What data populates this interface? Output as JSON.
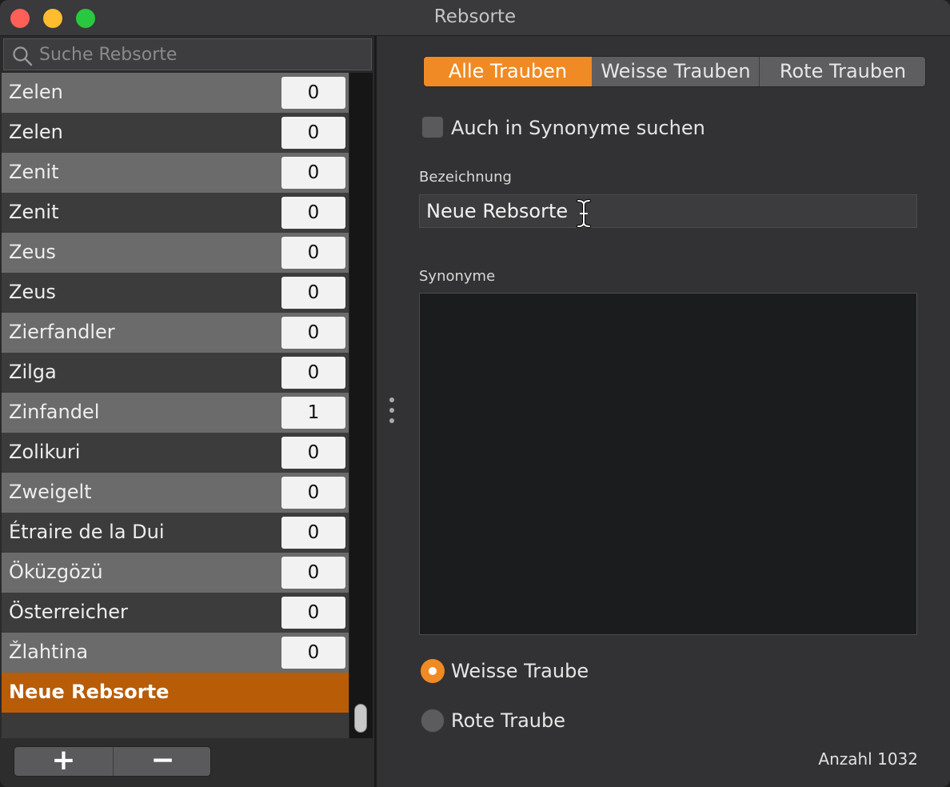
{
  "window": {
    "title": "Rebsorte"
  },
  "search": {
    "placeholder": "Suche Rebsorte"
  },
  "list": {
    "rows": [
      {
        "name": "Zelen",
        "count": "0"
      },
      {
        "name": "Zelen",
        "count": "0"
      },
      {
        "name": "Zenit",
        "count": "0"
      },
      {
        "name": "Zenit",
        "count": "0"
      },
      {
        "name": "Zeus",
        "count": "0"
      },
      {
        "name": "Zeus",
        "count": "0"
      },
      {
        "name": "Zierfandler",
        "count": "0"
      },
      {
        "name": "Zilga",
        "count": "0"
      },
      {
        "name": "Zinfandel",
        "count": "1"
      },
      {
        "name": "Zolikuri",
        "count": "0"
      },
      {
        "name": "Zweigelt",
        "count": "0"
      },
      {
        "name": "Étraire de la Dui",
        "count": "0"
      },
      {
        "name": "Öküzgözü",
        "count": "0"
      },
      {
        "name": "Österreicher",
        "count": "0"
      },
      {
        "name": "Žlahtina",
        "count": "0"
      },
      {
        "name": "Neue Rebsorte",
        "count": ""
      }
    ],
    "selected_index": 15
  },
  "bottom_buttons": {
    "add": "+",
    "remove": "−"
  },
  "tabs": [
    {
      "label": "Alle Trauben",
      "selected": true
    },
    {
      "label": "Weisse Trauben",
      "selected": false
    },
    {
      "label": "Rote Trauben",
      "selected": false
    }
  ],
  "synonym_search": {
    "label": "Auch in Synonyme suchen",
    "checked": false
  },
  "bezeichnung": {
    "label": "Bezeichnung",
    "value": "Neue Rebsorte"
  },
  "synonyme": {
    "label": "Synonyme",
    "value": ""
  },
  "grape_type": {
    "white_label": "Weisse Traube",
    "red_label": "Rote Traube",
    "selected": "white"
  },
  "footer": {
    "count_text": "Anzahl 1032"
  },
  "colors": {
    "accent": "#f08a24",
    "selected_row": "#b85c07"
  }
}
